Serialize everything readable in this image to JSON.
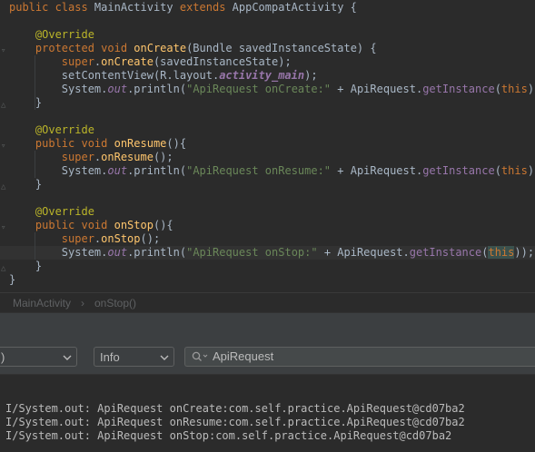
{
  "editor": {
    "lines": [
      {
        "parts": [
          [
            "kw",
            "public class "
          ],
          [
            "",
            "MainActivity "
          ],
          [
            "kw",
            "extends "
          ],
          [
            "",
            "AppCompatActivity {"
          ]
        ]
      },
      {
        "parts": []
      },
      {
        "parts": [
          [
            "",
            "    "
          ],
          [
            "ann",
            "@Override"
          ]
        ]
      },
      {
        "parts": [
          [
            "",
            "    "
          ],
          [
            "kw",
            "protected void "
          ],
          [
            "fn",
            "onCreate"
          ],
          [
            "",
            "(Bundle savedInstanceState) {"
          ]
        ]
      },
      {
        "parts": [
          [
            "",
            "        "
          ],
          [
            "kw",
            "super"
          ],
          [
            "",
            "."
          ],
          [
            "fn",
            "onCreate"
          ],
          [
            "",
            "(savedInstanceState);"
          ]
        ]
      },
      {
        "parts": [
          [
            "",
            "        setContentView(R.layout."
          ],
          [
            "fld-b",
            "activity_main"
          ],
          [
            "",
            "); "
          ]
        ]
      },
      {
        "parts": [
          [
            "",
            "        System."
          ],
          [
            "fld",
            "out"
          ],
          [
            "",
            ".println("
          ],
          [
            "str",
            "\"ApiRequest onCreate:\""
          ],
          [
            "",
            " + ApiRequest."
          ],
          [
            "inst",
            "getInstance"
          ],
          [
            "",
            "("
          ],
          [
            "kw",
            "this"
          ],
          [
            "",
            "));"
          ]
        ]
      },
      {
        "parts": [
          [
            "",
            "    }"
          ]
        ]
      },
      {
        "parts": []
      },
      {
        "parts": [
          [
            "",
            "    "
          ],
          [
            "ann",
            "@Override"
          ]
        ]
      },
      {
        "parts": [
          [
            "",
            "    "
          ],
          [
            "kw",
            "public void "
          ],
          [
            "fn",
            "onResume"
          ],
          [
            "",
            "(){"
          ]
        ]
      },
      {
        "parts": [
          [
            "",
            "        "
          ],
          [
            "kw",
            "super"
          ],
          [
            "",
            "."
          ],
          [
            "fn",
            "onResume"
          ],
          [
            "",
            "();"
          ]
        ]
      },
      {
        "parts": [
          [
            "",
            "        System."
          ],
          [
            "fld",
            "out"
          ],
          [
            "",
            ".println("
          ],
          [
            "str",
            "\"ApiRequest onResume:\""
          ],
          [
            "",
            " + ApiRequest."
          ],
          [
            "inst",
            "getInstance"
          ],
          [
            "",
            "("
          ],
          [
            "kw",
            "this"
          ],
          [
            "",
            "));"
          ]
        ]
      },
      {
        "parts": [
          [
            "",
            "    }"
          ]
        ]
      },
      {
        "parts": []
      },
      {
        "parts": [
          [
            "",
            "    "
          ],
          [
            "ann",
            "@Override"
          ]
        ]
      },
      {
        "parts": [
          [
            "",
            "    "
          ],
          [
            "kw",
            "public void "
          ],
          [
            "fn",
            "onStop"
          ],
          [
            "",
            "(){"
          ]
        ]
      },
      {
        "parts": [
          [
            "",
            "        "
          ],
          [
            "kw",
            "super"
          ],
          [
            "",
            "."
          ],
          [
            "fn",
            "onStop"
          ],
          [
            "",
            "();"
          ]
        ]
      },
      {
        "parts": [
          [
            "",
            "        System."
          ],
          [
            "fld",
            "out"
          ],
          [
            "",
            ".println("
          ],
          [
            "str",
            "\"ApiRequest onStop:\""
          ],
          [
            "",
            " + ApiRequest."
          ],
          [
            "inst",
            "getInstance"
          ],
          [
            "",
            "("
          ],
          [
            "hl-this",
            "this"
          ],
          [
            "",
            "));"
          ]
        ]
      },
      {
        "parts": [
          [
            "",
            "    }"
          ]
        ]
      },
      {
        "parts": [
          [
            "",
            "}"
          ]
        ]
      }
    ]
  },
  "breadcrumb": {
    "class_name": "MainActivity",
    "separator": "›",
    "method_name": "onStop()"
  },
  "logcat": {
    "device_select_value": ")",
    "level_select_value": "Info",
    "search_value": "ApiRequest",
    "search_icon": "search-icon",
    "lines": [
      "I/System.out: ApiRequest onCreate:com.self.practice.ApiRequest@cd07ba2",
      "I/System.out: ApiRequest onResume:com.self.practice.ApiRequest@cd07ba2",
      "I/System.out: ApiRequest onStop:com.self.practice.ApiRequest@cd07ba2"
    ]
  },
  "colors": {
    "editor_bg": "#2b2b2b",
    "keyword": "#cc7832",
    "annotation": "#bbb529",
    "method_decl": "#ffc66d",
    "string": "#6a8759",
    "field": "#9876aa",
    "panel_bg": "#3c3f41"
  }
}
